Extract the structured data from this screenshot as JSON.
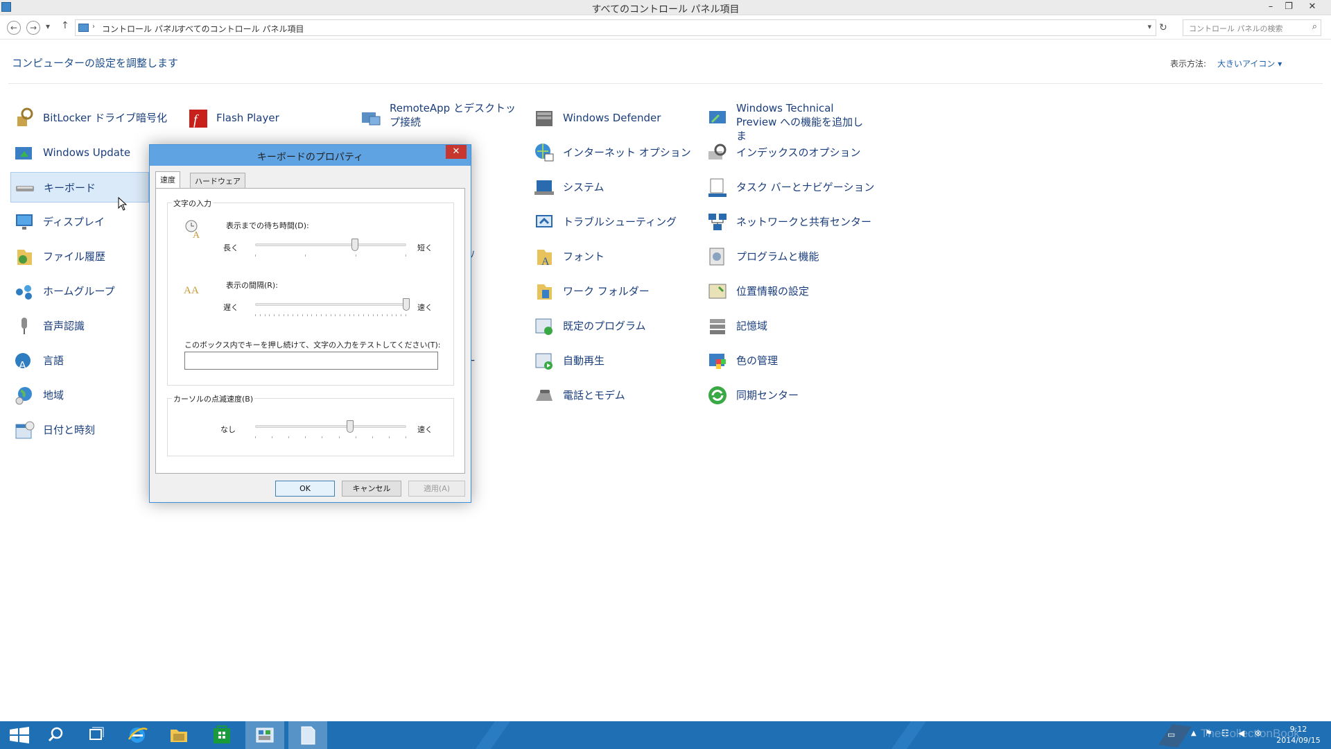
{
  "window": {
    "title": "すべてのコントロール パネル項目",
    "controls": {
      "minimize": "–",
      "restore": "❐",
      "close": "✕"
    }
  },
  "address": {
    "back": "←",
    "forward": "→",
    "recent": "▾",
    "up": "↑",
    "crumbs": [
      "コントロール パネル",
      "すべてのコントロール パネル項目"
    ],
    "separator": "›",
    "dropdown": "▾",
    "refresh": "↻",
    "search_placeholder": "コントロール パネルの検索",
    "search_icon": "⌕"
  },
  "header": {
    "title": "コンピューターの設定を調整します",
    "view_label": "表示方法:",
    "view_value": "大きいアイコン ▾"
  },
  "items": {
    "col1": [
      "BitLocker ドライブ暗号化",
      "Windows Update",
      "キーボード",
      "ディスプレイ",
      "ファイル履歴",
      "ホームグループ",
      "音声認識",
      "言語",
      "地域",
      "日付と時刻"
    ],
    "col2": [
      "Flash Player"
    ],
    "col3": [
      "RemoteApp とデスクトップ接続"
    ],
    "col4": [
      "Windows Defender",
      "インターネット オプション",
      "システム",
      "トラブルシューティング",
      "フォント",
      "ワーク フォルダー",
      "既定のプログラム",
      "自動再生",
      "電話とモデム"
    ],
    "col5": [
      "Windows Technical Preview への機能を追加しま",
      "インデックスのオプション",
      "タスク バーとナビゲーション",
      "ネットワークと共有センター",
      "プログラムと機能",
      "位置情報の設定",
      "記憶域",
      "色の管理",
      "同期センター"
    ]
  },
  "dialog": {
    "title": "キーボードのプロパティ",
    "close": "✕",
    "tabs": [
      "速度",
      "ハードウェア"
    ],
    "char_group": "文字の入力",
    "delay_label": "表示までの待ち時間(D):",
    "delay_left": "長く",
    "delay_right": "短く",
    "delay_value": 0.66,
    "rate_label": "表示の間隔(R):",
    "rate_left": "遅く",
    "rate_right": "速く",
    "rate_value": 1.0,
    "test_label": "このボックス内でキーを押し続けて、文字の入力をテストしてください(T):",
    "test_value": "",
    "cursor_group": "カーソルの点滅速度(B)",
    "blink_left": "なし",
    "blink_right": "速く",
    "blink_value": 0.63,
    "ok": "OK",
    "cancel": "キャンセル",
    "apply": "適用(A)"
  },
  "taskbar": {
    "time": "9:12",
    "date": "2014/09/15",
    "tray_up": "▲",
    "watermark": "TheCollectionBook"
  },
  "colors": {
    "taskbar": "#1f6fb5",
    "dialog_title": "#5fa3e3",
    "link": "#1a3d7c",
    "close": "#c7372f"
  }
}
